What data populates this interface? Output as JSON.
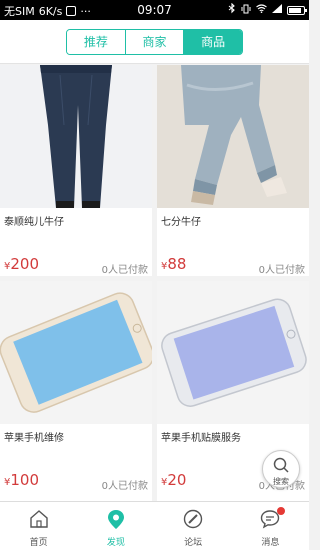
{
  "status_bar": {
    "carrier": "无SIM",
    "speed": "6K/s",
    "dots": "···",
    "time": "09:07"
  },
  "segments": [
    {
      "label": "推荐",
      "active": false
    },
    {
      "label": "商家",
      "active": false
    },
    {
      "label": "商品",
      "active": true
    }
  ],
  "products": [
    {
      "title": "泰顺纯儿牛仔",
      "currency": "¥",
      "price": "200",
      "sold": "0人已付款"
    },
    {
      "title": "七分牛仔",
      "currency": "¥",
      "price": "88",
      "sold": "0人已付款"
    },
    {
      "title": "苹果手机维修",
      "currency": "¥",
      "price": "100",
      "sold": "0人已付款"
    },
    {
      "title": "苹果手机贴膜服务",
      "currency": "¥",
      "price": "20",
      "sold": "0人已付款"
    }
  ],
  "search_fab": {
    "label": "搜索",
    "icon": "search-icon"
  },
  "tabbar": [
    {
      "label": "首页",
      "icon": "home-icon",
      "active": false
    },
    {
      "label": "发现",
      "icon": "discover-icon",
      "active": true
    },
    {
      "label": "论坛",
      "icon": "forum-icon",
      "active": false
    },
    {
      "label": "消息",
      "icon": "message-icon",
      "active": false,
      "badge": true
    }
  ],
  "colors": {
    "accent": "#1fbfa6",
    "price": "#d23b3b",
    "badge": "#e53935"
  }
}
